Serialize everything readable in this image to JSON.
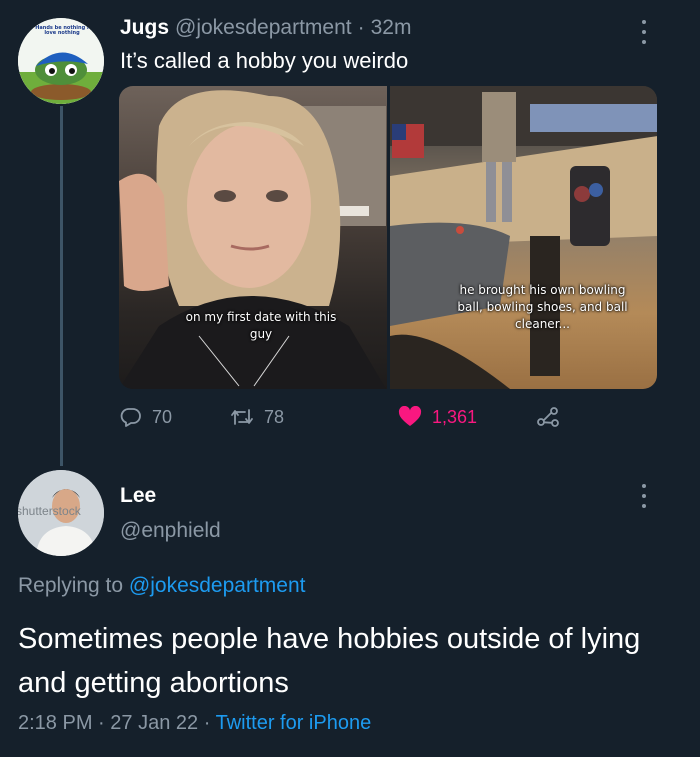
{
  "tweet": {
    "author_name": "Jugs",
    "handle": "@jokesdepartment",
    "separator": "·",
    "time": "32m",
    "text": "It’s called a hobby you weirdo",
    "avatar_caption": "Hands be nothing I love nothing",
    "media": [
      {
        "caption": "on my first date with this guy"
      },
      {
        "caption": "he brought his own bowling ball, bowling shoes, and ball cleaner..."
      }
    ],
    "actions": {
      "replies": "70",
      "retweets": "78",
      "likes": "1,361"
    },
    "like_color": "#f91880"
  },
  "reply": {
    "author_name": "Lee",
    "handle": "@enphield",
    "avatar_watermark": "shutterstock",
    "replying_prefix": "Replying to",
    "replying_to": "@jokesdepartment",
    "text": "Sometimes people have hobbies outside of lying and getting abortions",
    "time": "2:18 PM",
    "separator_1": "·",
    "date": "27 Jan 22",
    "separator_2": "·",
    "source": "Twitter for iPhone"
  },
  "theme": {
    "background": "#15202b",
    "secondary_text": "#8b98a5",
    "accent": "#1d9bf0"
  }
}
